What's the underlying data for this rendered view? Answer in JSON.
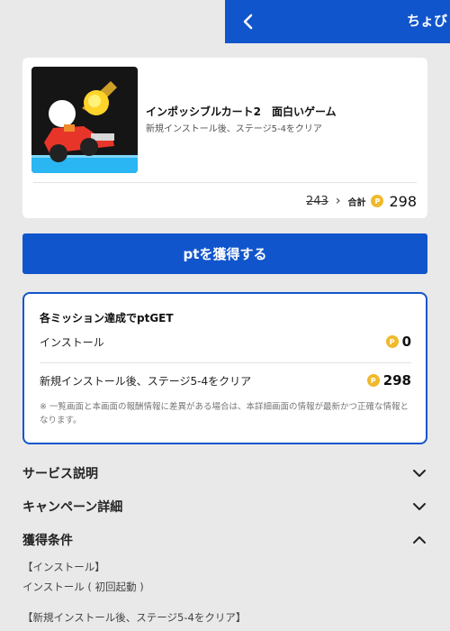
{
  "header": {
    "title": "ちょび"
  },
  "app": {
    "title": "インポッシブルカート2　面白いゲーム",
    "subtitle": "新規インストール後、ステージ5-4をクリア",
    "old_points": "243",
    "arrow": "›",
    "total_label": "合計",
    "coin_symbol": "P",
    "total_points": "298"
  },
  "cta": {
    "label": "ptを獲得する"
  },
  "missions": {
    "heading": "各ミッション達成でptGET",
    "items": [
      {
        "label": "インストール",
        "points": "0"
      },
      {
        "label": "新規インストール後、ステージ5-4をクリア",
        "points": "298"
      }
    ],
    "note": "※ 一覧画面と本画面の報酬情報に差異がある場合は、本詳細画面の情報が最新かつ正確な情報となります。"
  },
  "sections": {
    "service": "サービス説明",
    "campaign": "キャンペーン詳細",
    "conditions": "獲得条件"
  },
  "conditions": {
    "line1": "【インストール】",
    "line2": "インストール ( 初回起動 )",
    "line3": "【新規インストール後、ステージ5-4をクリア】"
  },
  "colors": {
    "primary": "#1155cc",
    "coin": "#f0b92c",
    "background": "#e9e9e9"
  },
  "icons": [
    "back-chevron-icon",
    "coin-icon",
    "chevron-down-icon",
    "chevron-up-icon"
  ]
}
